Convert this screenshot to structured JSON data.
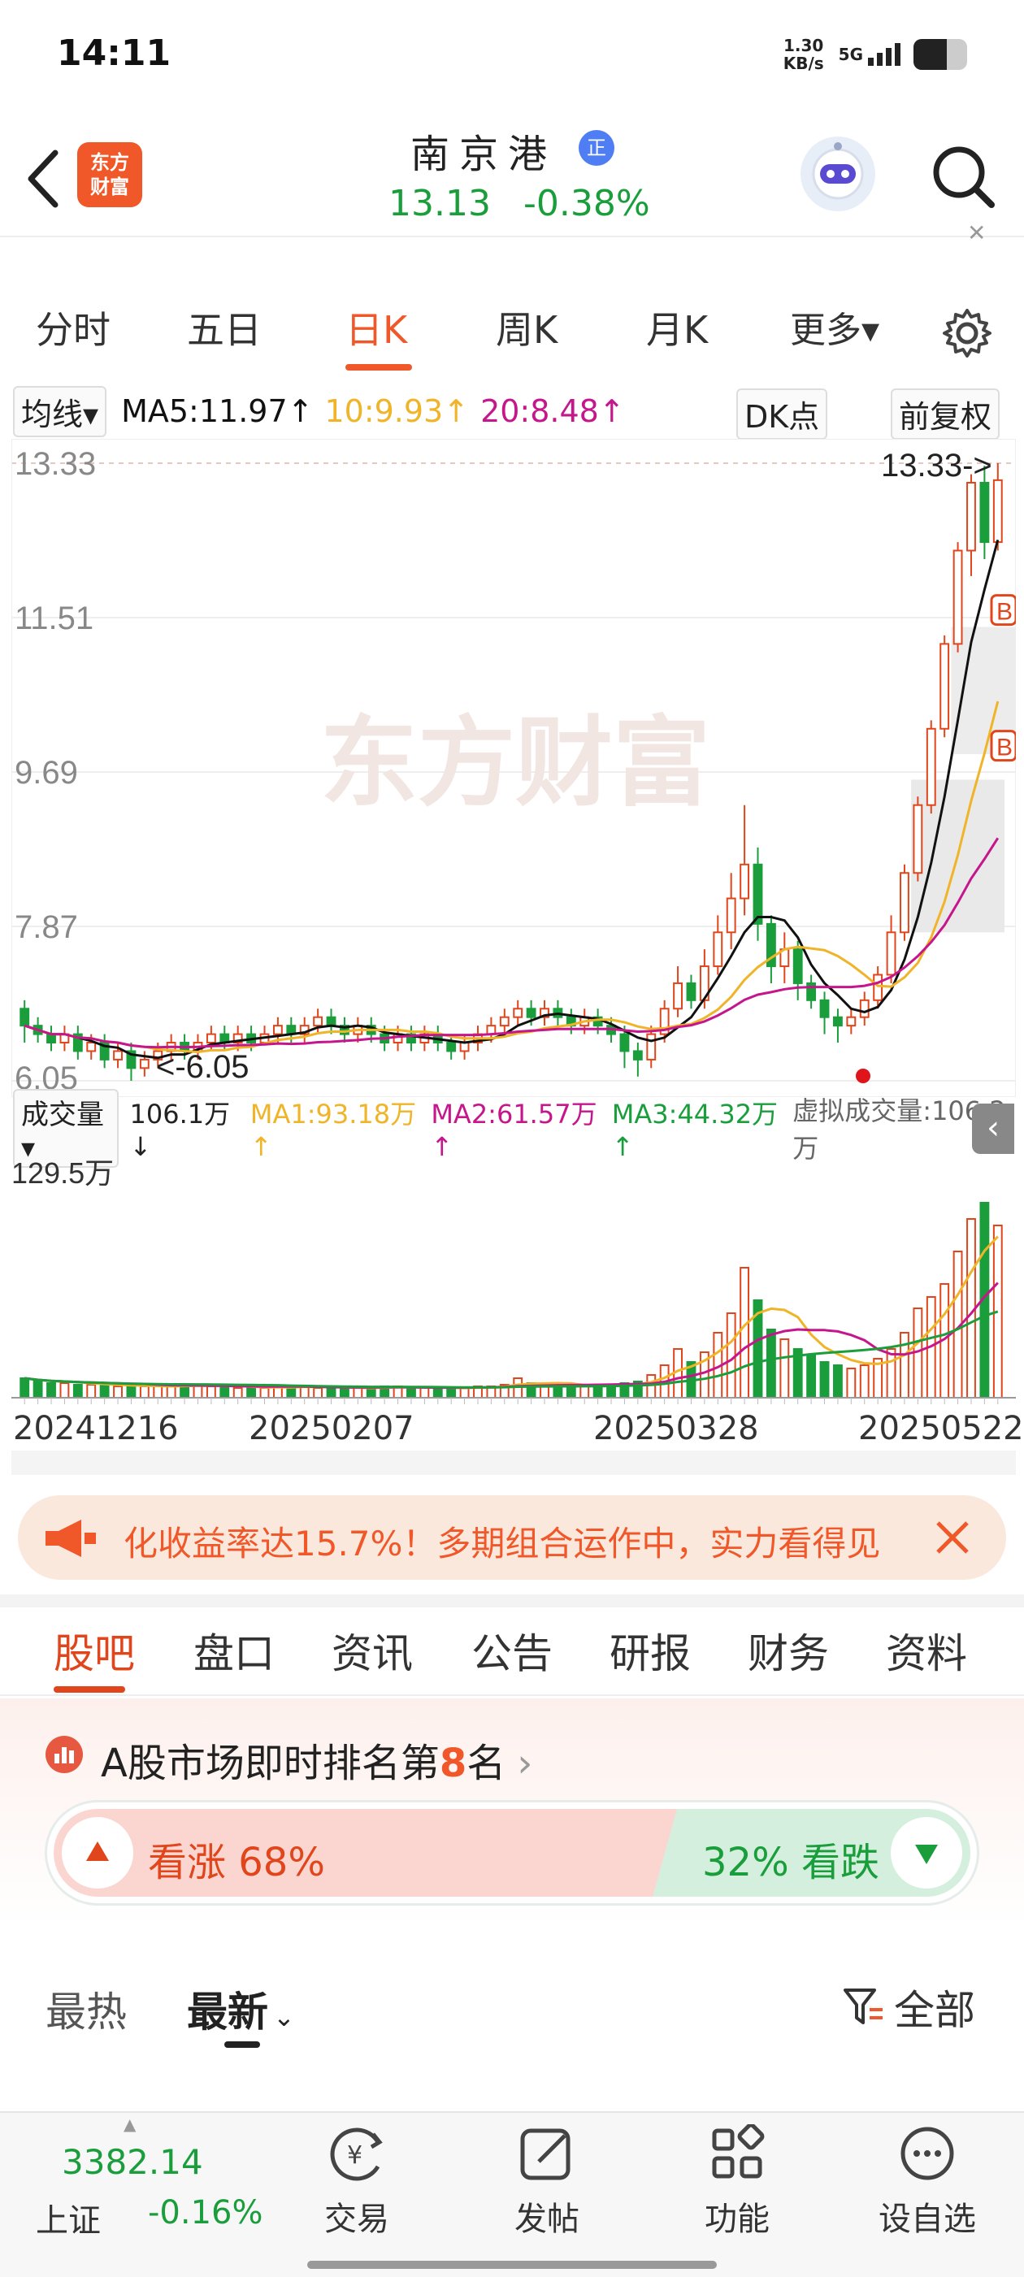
{
  "status_bar": {
    "time": "14:11",
    "net_speed_value": "1.30",
    "net_speed_unit": "KB/s",
    "network": "5G"
  },
  "header": {
    "logo_line1": "东方",
    "logo_line2": "财富",
    "stock_name": "南京港",
    "reg_badge": "正",
    "price": "13.13",
    "change_pct": "-0.38%"
  },
  "period_tabs": [
    {
      "label": "分时"
    },
    {
      "label": "五日"
    },
    {
      "label": "日K"
    },
    {
      "label": "周K"
    },
    {
      "label": "月K"
    },
    {
      "label": "更多▾"
    }
  ],
  "active_period": "日K",
  "ma_bar": {
    "type_label": "均线▾",
    "ma5": "MA5:11.97↑",
    "ma10": "10:9.93↑",
    "ma20": "20:8.48↑",
    "dk_label": "DK点",
    "adjust_label": "前复权"
  },
  "kline": {
    "watermark": "东方财富",
    "max_label": "13.33->",
    "min_label": "<-6.05",
    "y_ticks": [
      "13.33",
      "11.51",
      "9.69",
      "7.87",
      "6.05"
    ],
    "b_marker": "B"
  },
  "volume_bar": {
    "type_label": "成交量▾",
    "current": "106.1万↓",
    "ma1": "MA1:93.18万↑",
    "ma2": "MA2:61.57万↑",
    "ma3": "MA3:44.32万↑",
    "virtual": "虚拟成交量:106.2万",
    "top_tick": "129.5万"
  },
  "date_axis": [
    "20241216",
    "20250207",
    "20250328",
    "20250522"
  ],
  "ad_banner": {
    "text": "化收益率达15.7%！多期组合运作中，实力看得见"
  },
  "section_tabs": [
    {
      "label": "股吧"
    },
    {
      "label": "盘口"
    },
    {
      "label": "资讯"
    },
    {
      "label": "公告"
    },
    {
      "label": "研报"
    },
    {
      "label": "财务"
    },
    {
      "label": "资料"
    }
  ],
  "ranking": {
    "prefix": "A股市场即时排名第",
    "rank": "8",
    "suffix": "名"
  },
  "sentiment": {
    "bull": "看涨 68%",
    "bear": "32% 看跌",
    "bull_fraction": 0.68
  },
  "feed_filter": {
    "hot": "最热",
    "new": "最新",
    "all": "全部"
  },
  "bottom_bar": {
    "index_value": "3382.14",
    "index_name": "上证",
    "index_change": "-0.16%",
    "nav": [
      {
        "label": "交易"
      },
      {
        "label": "发帖"
      },
      {
        "label": "功能"
      },
      {
        "label": "设自选"
      }
    ]
  },
  "colors": {
    "accent": "#f0582a",
    "up": "#e0451b",
    "down": "#1a9e3c",
    "ma5": "#111111",
    "ma10": "#f0b429",
    "ma20": "#c5168c"
  },
  "chart_data": {
    "type": "candlestick",
    "ylim": [
      6.05,
      13.33
    ],
    "x_ticks": [
      "20241216",
      "20250207",
      "20250328",
      "20250522"
    ],
    "candles": [
      [
        6.9,
        6.7,
        7.0,
        6.5
      ],
      [
        6.7,
        6.6,
        6.8,
        6.5
      ],
      [
        6.6,
        6.5,
        6.7,
        6.4
      ],
      [
        6.5,
        6.6,
        6.7,
        6.4
      ],
      [
        6.6,
        6.4,
        6.7,
        6.3
      ],
      [
        6.4,
        6.5,
        6.6,
        6.3
      ],
      [
        6.5,
        6.3,
        6.6,
        6.2
      ],
      [
        6.3,
        6.4,
        6.5,
        6.2
      ],
      [
        6.4,
        6.2,
        6.5,
        6.05
      ],
      [
        6.2,
        6.3,
        6.4,
        6.1
      ],
      [
        6.3,
        6.4,
        6.5,
        6.2
      ],
      [
        6.4,
        6.5,
        6.6,
        6.3
      ],
      [
        6.5,
        6.4,
        6.6,
        6.3
      ],
      [
        6.4,
        6.5,
        6.6,
        6.3
      ],
      [
        6.5,
        6.6,
        6.7,
        6.4
      ],
      [
        6.6,
        6.5,
        6.7,
        6.4
      ],
      [
        6.5,
        6.6,
        6.7,
        6.4
      ],
      [
        6.6,
        6.5,
        6.7,
        6.4
      ],
      [
        6.5,
        6.6,
        6.7,
        6.5
      ],
      [
        6.6,
        6.7,
        6.8,
        6.5
      ],
      [
        6.7,
        6.6,
        6.8,
        6.5
      ],
      [
        6.6,
        6.7,
        6.8,
        6.5
      ],
      [
        6.7,
        6.8,
        6.9,
        6.6
      ],
      [
        6.8,
        6.7,
        6.9,
        6.6
      ],
      [
        6.7,
        6.6,
        6.8,
        6.5
      ],
      [
        6.6,
        6.7,
        6.8,
        6.5
      ],
      [
        6.7,
        6.6,
        6.8,
        6.5
      ],
      [
        6.6,
        6.5,
        6.7,
        6.4
      ],
      [
        6.5,
        6.6,
        6.7,
        6.4
      ],
      [
        6.6,
        6.5,
        6.7,
        6.4
      ],
      [
        6.5,
        6.6,
        6.7,
        6.4
      ],
      [
        6.6,
        6.5,
        6.7,
        6.4
      ],
      [
        6.5,
        6.4,
        6.6,
        6.3
      ],
      [
        6.4,
        6.5,
        6.6,
        6.3
      ],
      [
        6.5,
        6.6,
        6.7,
        6.4
      ],
      [
        6.6,
        6.7,
        6.8,
        6.5
      ],
      [
        6.7,
        6.8,
        6.9,
        6.6
      ],
      [
        6.8,
        6.9,
        7.0,
        6.7
      ],
      [
        6.9,
        6.8,
        7.0,
        6.7
      ],
      [
        6.8,
        6.9,
        7.0,
        6.7
      ],
      [
        6.9,
        6.8,
        7.0,
        6.7
      ],
      [
        6.8,
        6.7,
        6.9,
        6.6
      ],
      [
        6.7,
        6.8,
        6.9,
        6.6
      ],
      [
        6.8,
        6.7,
        6.9,
        6.6
      ],
      [
        6.7,
        6.6,
        6.8,
        6.5
      ],
      [
        6.6,
        6.4,
        6.7,
        6.2
      ],
      [
        6.4,
        6.3,
        6.5,
        6.1
      ],
      [
        6.3,
        6.6,
        6.7,
        6.2
      ],
      [
        6.6,
        6.9,
        7.0,
        6.5
      ],
      [
        6.9,
        7.2,
        7.4,
        6.8
      ],
      [
        7.2,
        7.0,
        7.3,
        6.9
      ],
      [
        7.0,
        7.4,
        7.6,
        6.9
      ],
      [
        7.4,
        7.8,
        8.0,
        7.3
      ],
      [
        7.8,
        8.2,
        8.5,
        7.6
      ],
      [
        8.2,
        8.6,
        9.3,
        8.0
      ],
      [
        8.6,
        7.9,
        8.8,
        7.7
      ],
      [
        7.9,
        7.4,
        8.0,
        7.2
      ],
      [
        7.4,
        7.6,
        7.8,
        7.2
      ],
      [
        7.6,
        7.2,
        7.7,
        7.0
      ],
      [
        7.2,
        7.0,
        7.3,
        6.9
      ],
      [
        7.0,
        6.8,
        7.1,
        6.6
      ],
      [
        6.8,
        6.7,
        6.9,
        6.5
      ],
      [
        6.7,
        6.8,
        6.9,
        6.6
      ],
      [
        6.8,
        7.0,
        7.1,
        6.7
      ],
      [
        7.0,
        7.3,
        7.4,
        6.9
      ],
      [
        7.3,
        7.8,
        8.0,
        7.2
      ],
      [
        7.8,
        8.5,
        8.6,
        7.7
      ],
      [
        8.5,
        9.3,
        9.4,
        8.4
      ],
      [
        9.3,
        10.2,
        10.3,
        9.2
      ],
      [
        10.2,
        11.2,
        11.3,
        10.1
      ],
      [
        11.2,
        12.3,
        12.4,
        11.1
      ],
      [
        12.3,
        13.1,
        13.2,
        12.0
      ],
      [
        13.1,
        12.4,
        13.3,
        12.2
      ],
      [
        12.4,
        13.13,
        13.33,
        12.3
      ]
    ],
    "volume_max": "129.5万",
    "volume_values": [
      12,
      10,
      9,
      9,
      8,
      8,
      8,
      7,
      7,
      7,
      7,
      7,
      8,
      8,
      7,
      7,
      6,
      6,
      6,
      7,
      7,
      7,
      6,
      6,
      6,
      6,
      6,
      7,
      7,
      6,
      6,
      6,
      6,
      6,
      7,
      7,
      8,
      12,
      9,
      8,
      8,
      7,
      7,
      7,
      8,
      9,
      10,
      14,
      20,
      30,
      22,
      28,
      40,
      52,
      80,
      60,
      42,
      36,
      30,
      26,
      22,
      20,
      18,
      20,
      24,
      30,
      40,
      55,
      62,
      70,
      90,
      110,
      120,
      106
    ]
  }
}
